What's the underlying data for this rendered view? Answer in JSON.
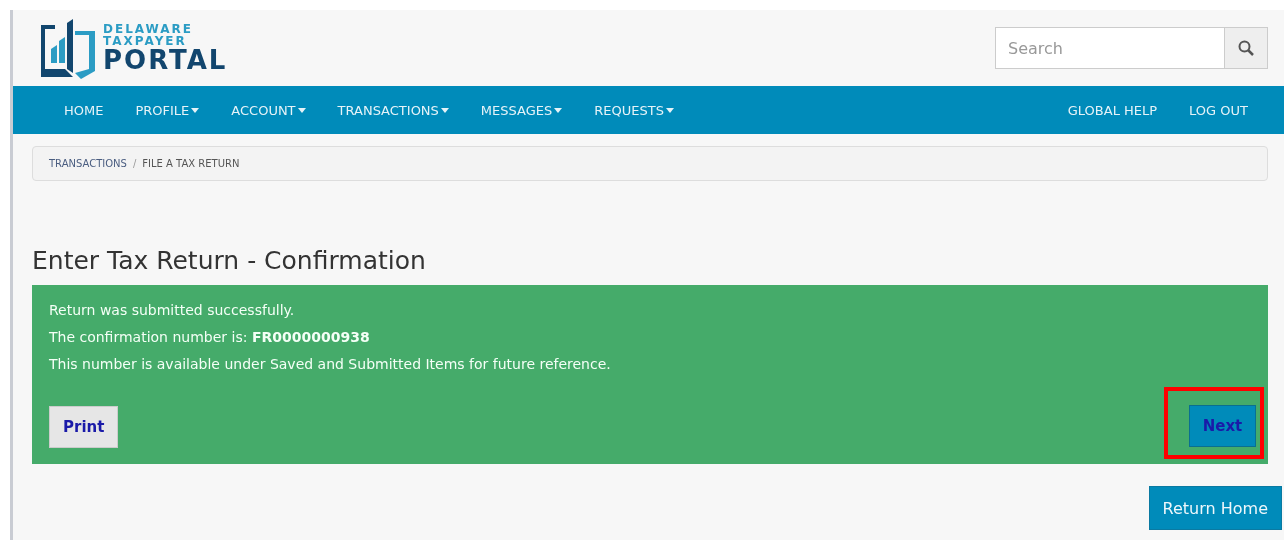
{
  "logo": {
    "line1": "DELAWARE",
    "line2": "TAXPAYER",
    "line3": "PORTAL"
  },
  "search": {
    "placeholder": "Search"
  },
  "nav": {
    "left": [
      {
        "label": "HOME",
        "has_menu": false
      },
      {
        "label": "PROFILE",
        "has_menu": true
      },
      {
        "label": "ACCOUNT",
        "has_menu": true
      },
      {
        "label": "TRANSACTIONS",
        "has_menu": true
      },
      {
        "label": "MESSAGES",
        "has_menu": true
      },
      {
        "label": "REQUESTS",
        "has_menu": true
      }
    ],
    "right": [
      {
        "label": "GLOBAL HELP",
        "has_menu": false
      },
      {
        "label": "LOG OUT",
        "has_menu": false
      }
    ]
  },
  "breadcrumb": {
    "items": [
      "TRANSACTIONS",
      "FILE A TAX RETURN"
    ],
    "separator": "/"
  },
  "title": "Enter Tax Return - Confirmation",
  "confirmation": {
    "lines": [
      "Return was submitted successfully.",
      "The confirmation number is: **FR0000000938**",
      "This number is available under Saved and Submitted Items for future reference."
    ],
    "print_button": "Print",
    "next_button": {
      "label": "Next",
      "highlighted": true
    }
  },
  "return_home_button": "Return Home"
}
